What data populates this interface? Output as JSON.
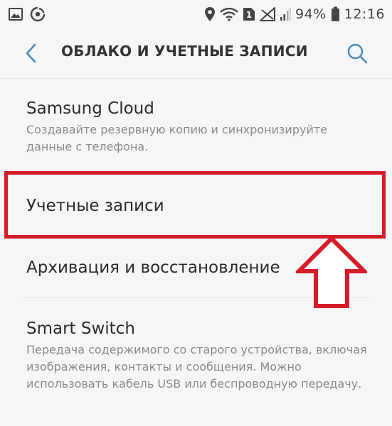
{
  "status_bar": {
    "icons_left": [
      "gallery-icon",
      "data-saver-icon"
    ],
    "icons_right": [
      "location-icon",
      "wifi-icon",
      "sim1-icon",
      "no-signal-icon",
      "signal-icon"
    ],
    "sim_label": "1",
    "battery": "94%",
    "time": "12:16"
  },
  "header": {
    "title": "ОБЛАКО И УЧЕТНЫЕ ЗАПИСИ",
    "back_icon": "chevron-left-icon",
    "search_icon": "search-icon"
  },
  "items": [
    {
      "title": "Samsung Cloud",
      "subtitle": "Создавайте резервную копию и синхронизируйте данные с телефона."
    },
    {
      "title": "Учетные записи",
      "subtitle": ""
    },
    {
      "title": "Архивация и восстановление",
      "subtitle": ""
    },
    {
      "title": "Smart Switch",
      "subtitle": "Передача содержимого со старого устройства, включая изображения, контакты и сообщения. Можно использовать кабель USB или беспроводную передачу."
    }
  ],
  "colors": {
    "background": "#f5f6f8",
    "accent": "#4a88b8",
    "annotation": "#d51d29",
    "title_text": "#2b2b2b",
    "subtitle_text": "#8a8a8a"
  }
}
